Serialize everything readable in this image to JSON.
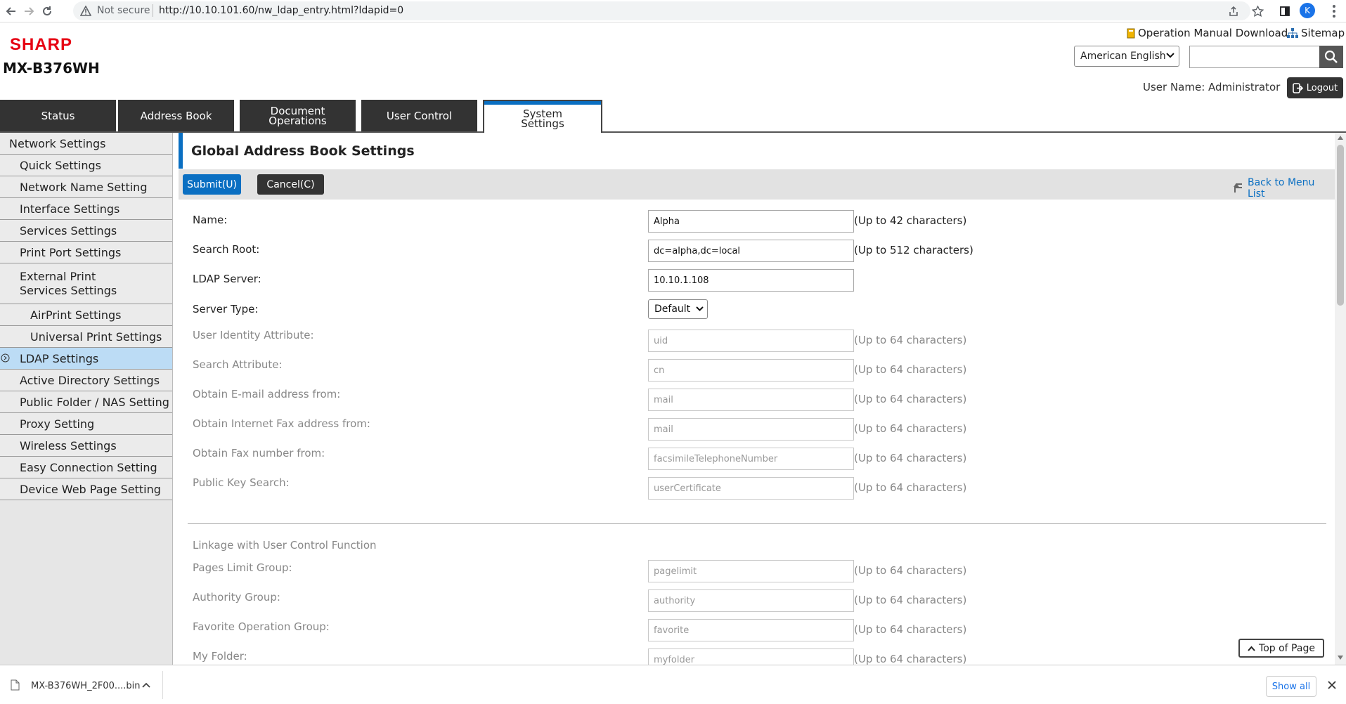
{
  "browser": {
    "security_label": "Not secure",
    "url": "http://10.10.101.60/nw_ldap_entry.html?ldapid=0",
    "profile_initial": "K"
  },
  "header": {
    "brand": "SHARP",
    "model": "MX-B376WH",
    "manual_link": "Operation Manual Download",
    "sitemap_link": "Sitemap",
    "language": "American English",
    "search_value": "",
    "user_name": "User Name: Administrator",
    "logout_label": "Logout"
  },
  "tabs": [
    {
      "label": "Status"
    },
    {
      "label": "Address Book"
    },
    {
      "label": "Document Operations"
    },
    {
      "label": "User Control"
    },
    {
      "label": "System Settings",
      "active": true
    }
  ],
  "sidebar": {
    "items": [
      {
        "label": "Network Settings"
      },
      {
        "label": "Quick Settings"
      },
      {
        "label": "Network Name Setting"
      },
      {
        "label": "Interface Settings"
      },
      {
        "label": "Services Settings"
      },
      {
        "label": "Print Port Settings"
      },
      {
        "label": "External Print Services Settings"
      },
      {
        "label": "AirPrint Settings"
      },
      {
        "label": "Universal Print Settings"
      },
      {
        "label": "LDAP Settings",
        "selected": true
      },
      {
        "label": "Active Directory Settings"
      },
      {
        "label": "Public Folder / NAS Setting"
      },
      {
        "label": "Proxy Setting"
      },
      {
        "label": "Wireless Settings"
      },
      {
        "label": "Easy Connection Setting"
      },
      {
        "label": "Device Web Page Setting"
      }
    ]
  },
  "content": {
    "title": "Global Address Book Settings",
    "submit_label": "Submit(U)",
    "cancel_label": "Cancel(C)",
    "back_label": "Back to Menu List",
    "fields": {
      "name": {
        "label": "Name:",
        "value": "Alpha",
        "hint": "(Up to 42 characters)"
      },
      "search_root": {
        "label": "Search Root:",
        "value": "dc=alpha,dc=local",
        "hint": "(Up to 512 characters)"
      },
      "ldap_server": {
        "label": "LDAP Server:",
        "value": "10.10.1.108"
      },
      "server_type": {
        "label": "Server Type:",
        "value": "Default"
      },
      "user_identity": {
        "label": "User Identity Attribute:",
        "value": "uid",
        "hint": "(Up to 64 characters)"
      },
      "search_attribute": {
        "label": "Search Attribute:",
        "value": "cn",
        "hint": "(Up to 64 characters)"
      },
      "email_from": {
        "label": "Obtain E-mail address from:",
        "value": "mail",
        "hint": "(Up to 64 characters)"
      },
      "ifax_from": {
        "label": "Obtain Internet Fax address from:",
        "value": "mail",
        "hint": "(Up to 64 characters)"
      },
      "fax_from": {
        "label": "Obtain Fax number from:",
        "value": "facsimileTelephoneNumber",
        "hint": "(Up to 64 characters)"
      },
      "public_key": {
        "label": "Public Key Search:",
        "value": "userCertificate",
        "hint": "(Up to 64 characters)"
      }
    },
    "linkage": {
      "heading": "Linkage with User Control Function",
      "fields": {
        "pages_limit": {
          "label": "Pages Limit Group:",
          "value": "pagelimit",
          "hint": "(Up to 64 characters)"
        },
        "authority": {
          "label": "Authority Group:",
          "value": "authority",
          "hint": "(Up to 64 characters)"
        },
        "favorite": {
          "label": "Favorite Operation Group:",
          "value": "favorite",
          "hint": "(Up to 64 characters)"
        },
        "my_folder": {
          "label": "My Folder:",
          "value": "myfolder",
          "hint": "(Up to 64 characters)"
        }
      }
    },
    "top_of_page_label": "Top of Page"
  },
  "download_bar": {
    "file_name": "MX-B376WH_2F00....bin",
    "show_all_label": "Show all"
  },
  "colors": {
    "accent": "#0a6fc2",
    "brand_red": "#e60012",
    "tab_dark": "#333333",
    "selected_item": "#bcdcf5"
  }
}
